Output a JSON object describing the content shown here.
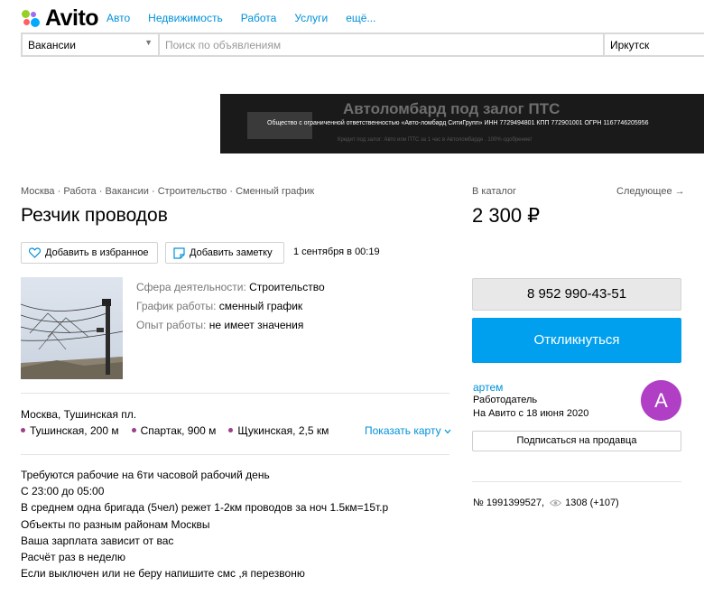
{
  "header": {
    "logo_text": "Avito",
    "nav": [
      "Авто",
      "Недвижимость",
      "Работа",
      "Услуги",
      "ещё..."
    ],
    "category_value": "Вакансии",
    "search_placeholder": "Поиск по объявлениям",
    "city_value": "Иркутск"
  },
  "banner": {
    "title": "Автоломбард под залог ПТС",
    "legal": "Общество с ограниченной ответственностью «Авто-ломбард СитиГрупп» ИНН 7729494801 КПП 772901001 ОГРН 1167746205956",
    "sub": "Кредит под залог: Авто или ПТС за 1 час в Автоломбарде . 100% одобрение!"
  },
  "listing": {
    "breadcrumb": [
      "Москва",
      "Работа",
      "Вакансии",
      "Строительство",
      "Сменный график"
    ],
    "breadcrumb_sep": " · ",
    "title": "Резчик проводов",
    "add_favorite": "Добавить в избранное",
    "add_note": "Добавить заметку",
    "date": "1 сентября в 00:19",
    "props": [
      {
        "key": "Сфера деятельности:",
        "value": "Строительство"
      },
      {
        "key": "График работы:",
        "value": "сменный график"
      },
      {
        "key": "Опыт работы:",
        "value": "не имеет значения"
      }
    ],
    "address": "Москва, Тушинская пл.",
    "metro": [
      {
        "name": "Тушинская, 200 м"
      },
      {
        "name": "Спартак, 900 м"
      },
      {
        "name": "Щукинская, 2,5 км"
      }
    ],
    "show_map": "Показать карту",
    "description": [
      "Требуются рабочие на 6ти часовой рабочий день",
      "С 23:00 до 05:00",
      "В среднем одна бригада (5чел) режет 1-2км проводов за ноч 1.5км=15т.р",
      "Объекты по разным районам Москвы",
      "Ваша зарплата зависит от вас",
      "Расчёт раз в неделю",
      "Если выключен или не беру напишите смс ,я перезвоню"
    ]
  },
  "sidebar": {
    "catalog_label": "В каталог",
    "next_label": "Следующее →",
    "price": "2 300 ₽",
    "phone": "8 952 990-43-51",
    "respond_button": "Откликнуться",
    "seller_name": "артем",
    "seller_role": "Работодатель",
    "seller_since": "На Авито с 18 июня 2020",
    "avatar_letter": "А",
    "avatar_color": "#b03fc6",
    "subscribe_button": "Подписаться на продавца",
    "item_number": "№ 1991399527,",
    "views": "1308 (+107)"
  },
  "colors": {
    "link": "#0091d9",
    "primary_button": "#00a0ef",
    "metro_dot": "#9b3f88"
  }
}
